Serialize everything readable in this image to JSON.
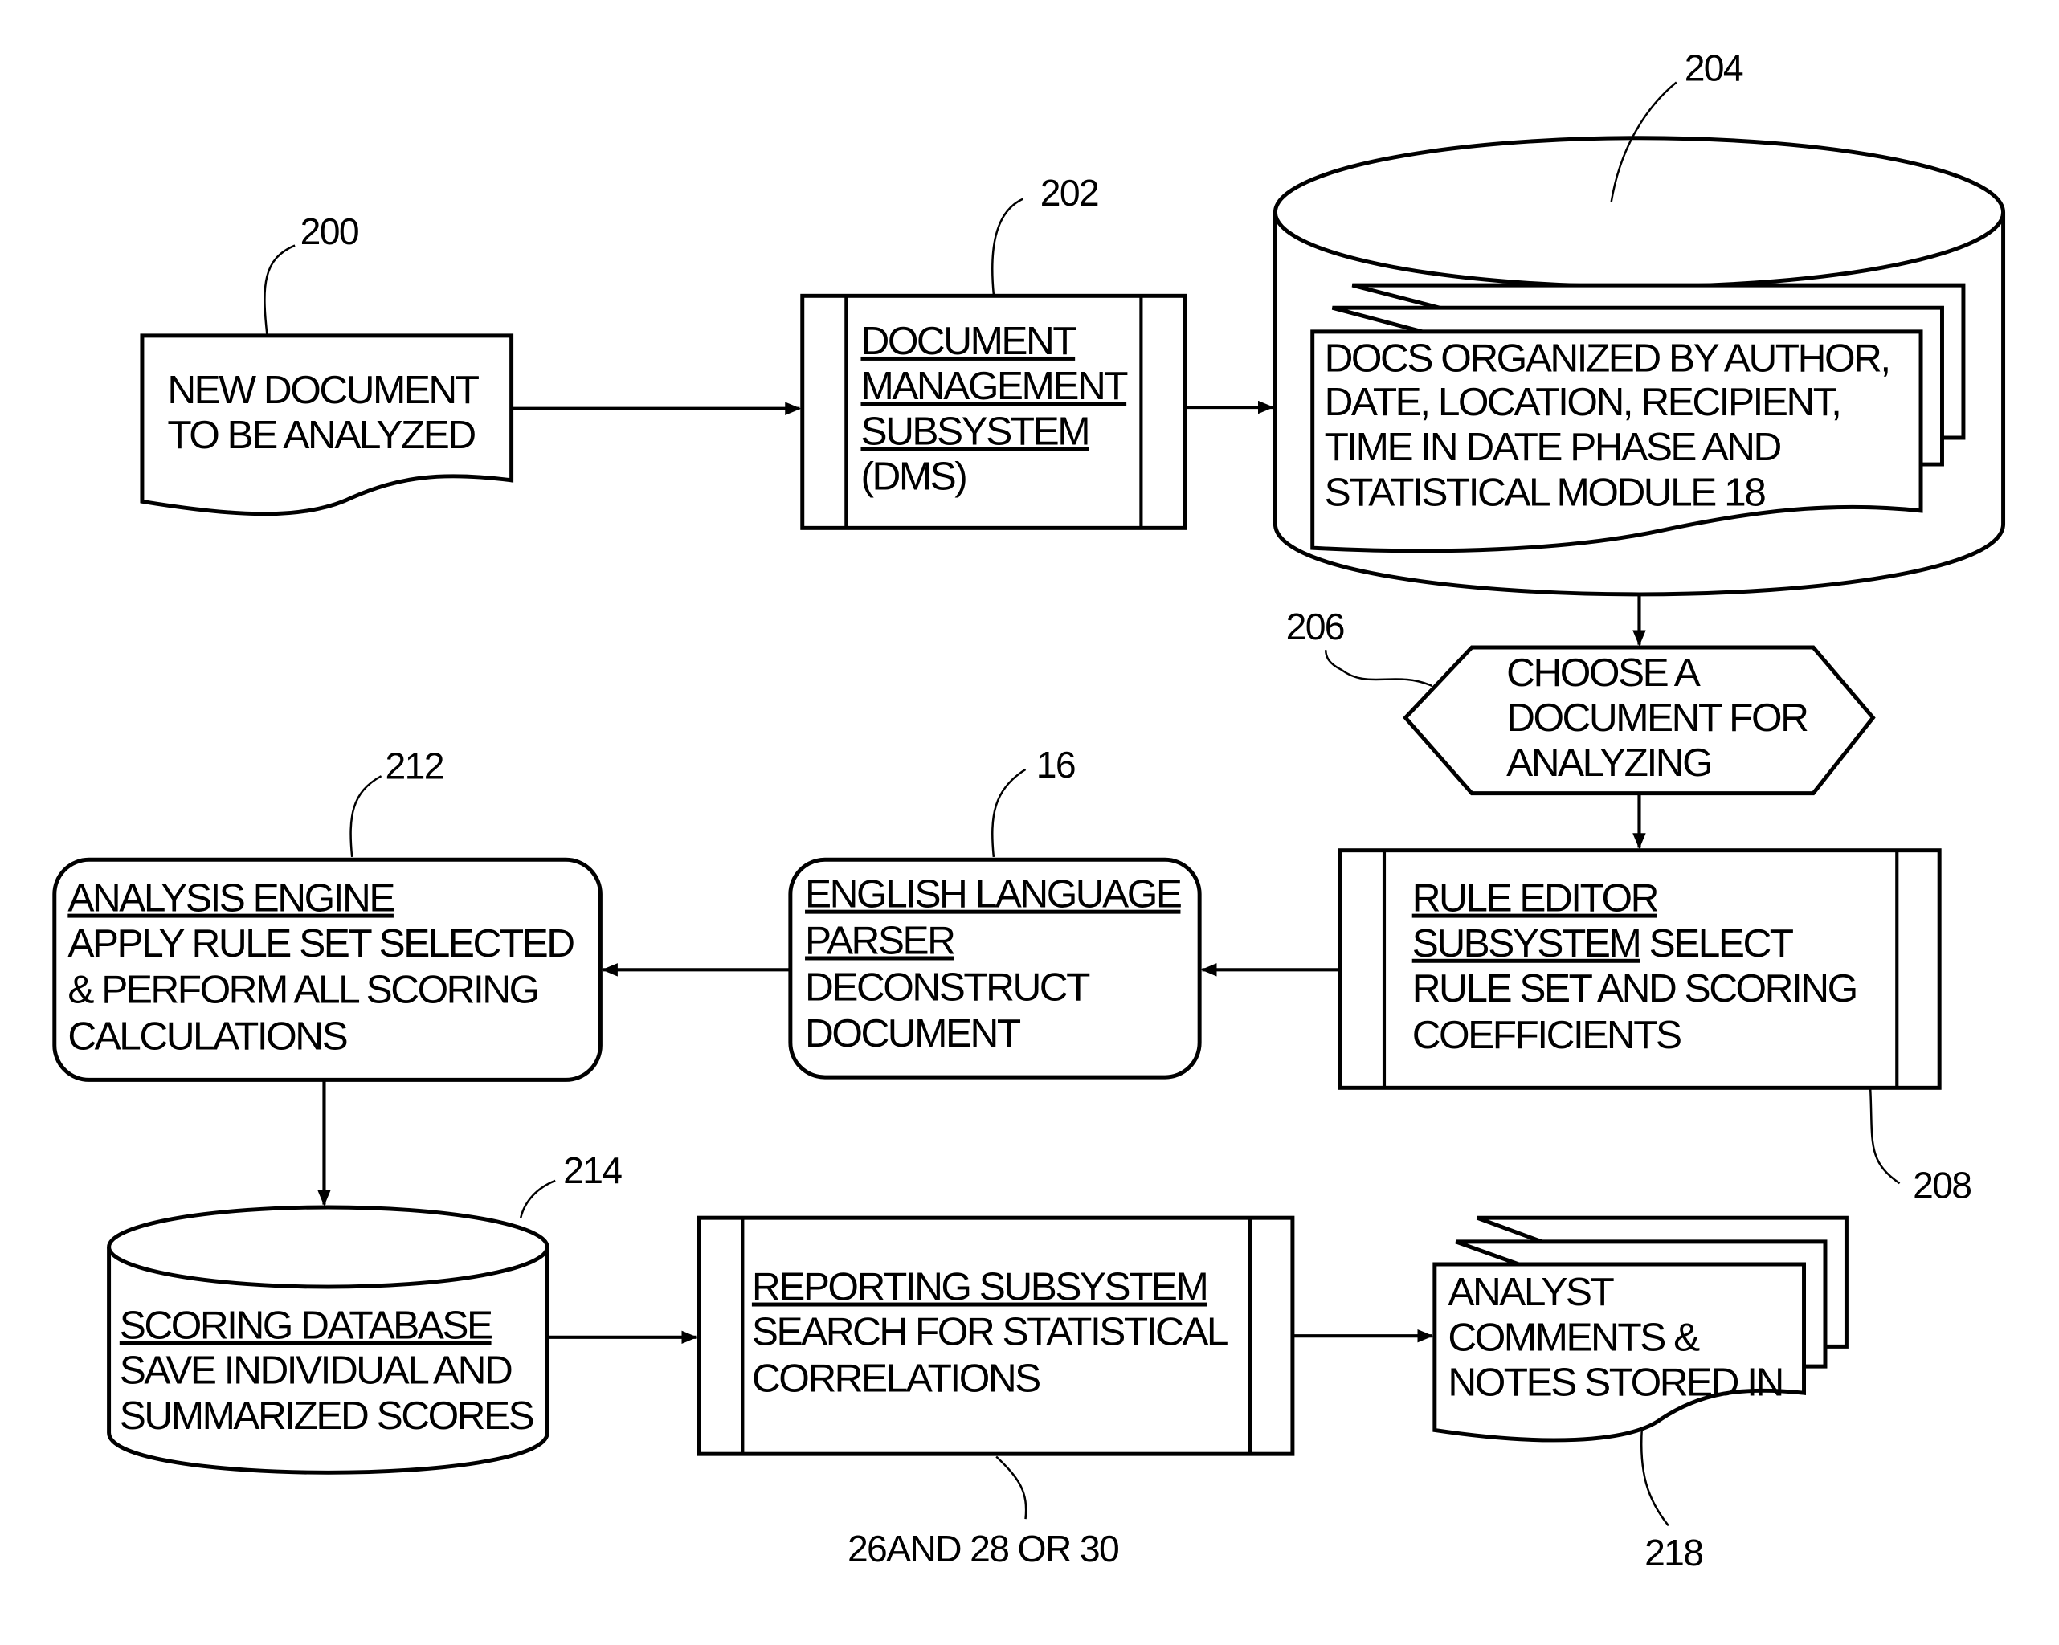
{
  "diagram": {
    "nodes": {
      "new_doc": {
        "ref": "200",
        "lines": [
          "NEW DOCUMENT",
          "TO BE ANALYZED"
        ]
      },
      "dms": {
        "ref": "202",
        "title_lines": [
          "DOCUMENT",
          "MANAGEMENT",
          "SUBSYSTEM"
        ],
        "lines": [
          "(DMS)"
        ]
      },
      "docs_db": {
        "ref": "204",
        "lines": [
          "DOCS ORGANIZED BY AUTHOR,",
          "DATE, LOCATION, RECIPIENT,",
          "TIME IN DATE PHASE AND",
          "STATISTICAL MODULE 18"
        ]
      },
      "choose": {
        "ref": "206",
        "lines": [
          "CHOOSE A",
          "DOCUMENT FOR",
          "ANALYZING"
        ]
      },
      "rule_editor": {
        "ref": "208",
        "title_lines": [
          "RULE EDITOR",
          "SUBSYSTEM"
        ],
        "title_suffix": " SELECT",
        "lines": [
          "RULE SET AND SCORING",
          "COEFFICIENTS"
        ]
      },
      "parser": {
        "ref": "16",
        "title_lines": [
          "ENGLISH LANGUAGE",
          "PARSER"
        ],
        "lines": [
          "DECONSTRUCT",
          "DOCUMENT"
        ]
      },
      "analysis": {
        "ref": "212",
        "title_lines": [
          "ANALYSIS ENGINE"
        ],
        "lines": [
          "APPLY RULE SET SELECTED",
          "& PERFORM ALL SCORING",
          "CALCULATIONS"
        ]
      },
      "scoring_db": {
        "ref": "214",
        "title_lines": [
          "SCORING DATABASE"
        ],
        "lines": [
          "SAVE INDIVIDUAL AND",
          "SUMMARIZED SCORES"
        ]
      },
      "reporting": {
        "ref": "26AND 28 OR 30",
        "title_lines": [
          "REPORTING SUBSYSTEM"
        ],
        "lines": [
          "SEARCH FOR STATISTICAL",
          "CORRELATIONS"
        ]
      },
      "notes": {
        "ref": "218",
        "lines": [
          "ANALYST",
          "COMMENTS &",
          "NOTES STORED IN"
        ]
      }
    },
    "edges": [
      {
        "from": "new_doc",
        "to": "dms"
      },
      {
        "from": "dms",
        "to": "docs_db"
      },
      {
        "from": "docs_db",
        "to": "choose"
      },
      {
        "from": "choose",
        "to": "rule_editor"
      },
      {
        "from": "rule_editor",
        "to": "parser"
      },
      {
        "from": "parser",
        "to": "analysis"
      },
      {
        "from": "analysis",
        "to": "scoring_db"
      },
      {
        "from": "scoring_db",
        "to": "reporting"
      },
      {
        "from": "reporting",
        "to": "notes"
      }
    ]
  }
}
